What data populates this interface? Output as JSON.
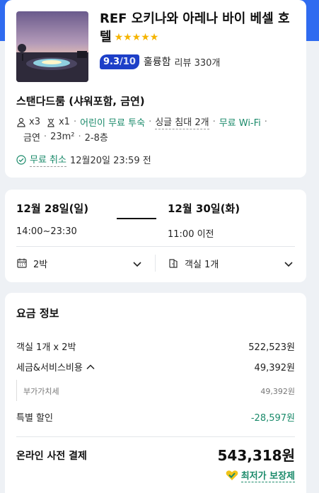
{
  "hotel": {
    "name": "REF 오키나와 아레나 바이 베셀 호텔",
    "stars": "★★★★★",
    "score": "9.3",
    "score_max": "/10",
    "grade": "훌륭함",
    "reviews": "리뷰 330개"
  },
  "room": {
    "name": "스탠다드룸 (샤워포함, 금연)",
    "adults": "x3",
    "children": "x1",
    "features_line1": [
      "어린이 무료 투숙",
      "싱글 침대 2개",
      "무료 Wi-Fi"
    ],
    "features_line2": [
      "금연",
      "23m²",
      "2-8층"
    ],
    "cancel_label": "무료 취소",
    "cancel_deadline": "12월20일 23:59 전"
  },
  "dates": {
    "checkin_date": "12월 28일(일)",
    "checkin_time": "14:00~23:30",
    "checkout_date": "12월 30일(화)",
    "checkout_time": "11:00 이전",
    "nights": "2박",
    "rooms": "객실 1개"
  },
  "price": {
    "title": "요금 정보",
    "room_line_label": "객실 1개 x 2박",
    "room_line_value": "522,523원",
    "tax_label": "세금&서비스비용",
    "tax_value": "49,392원",
    "vat_label": "부가가치세",
    "vat_value": "49,392원",
    "discount_label": "특별 할인",
    "discount_value": "-28,597원",
    "total_label": "온라인 사전 결제",
    "total_value": "543,318원",
    "guarantee": "최저가 보장제"
  },
  "colors": {
    "brand_blue": "#2f6bf0",
    "score_navy": "#1d3fc8",
    "accent_green": "#1a8a6a",
    "star_gold": "#f5b400"
  }
}
